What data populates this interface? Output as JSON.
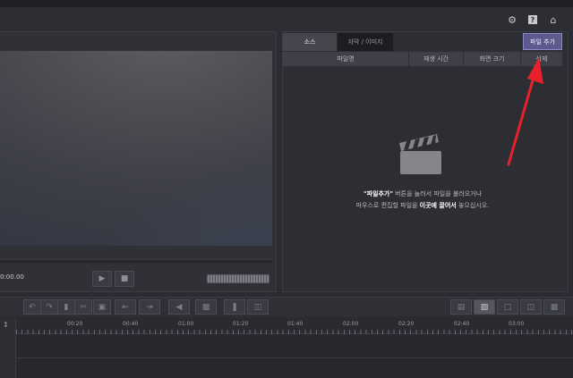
{
  "right_panel": {
    "tabs": [
      "소스",
      "자막 / 이미지"
    ],
    "add_file_label": "파일 추가",
    "columns": [
      "파일명",
      "재생 시간",
      "화면 크기",
      "삭제"
    ],
    "drop_hint": {
      "line1_em": "\"파일추가\"",
      "line1_rest": " 버튼을 눌러서 파일을 불러오거나",
      "line2_a": "마우스로 편집할 파일을 ",
      "line2_em": "이곳에 끌어서",
      "line2_b": " 놓으십시오."
    }
  },
  "preview": {
    "timecode": "0:00.00"
  },
  "timeline": {
    "ruler_labels": [
      "00:20",
      "00:40",
      "01:00",
      "01:20",
      "01:40",
      "02:00",
      "02:20",
      "02:40",
      "03:00"
    ]
  },
  "colors": {
    "accent": "#5d5a8e",
    "arrow": "#e8202a"
  },
  "icons": {
    "topbar": [
      "gear-icon",
      "help-icon",
      "home-icon"
    ],
    "player": [
      "play-icon",
      "stop-icon"
    ],
    "toolbar_left": [
      "undo-icon",
      "redo-icon",
      "delete-icon",
      "cut-icon",
      "crop-icon",
      "trim-start-icon",
      "trim-end-icon",
      "mute-icon",
      "screen-icon",
      "split-icon",
      "merge-icon"
    ],
    "toolbar_right": [
      "open-project-icon",
      "folder-icon",
      "save-icon",
      "export-icon",
      "render-icon"
    ]
  }
}
